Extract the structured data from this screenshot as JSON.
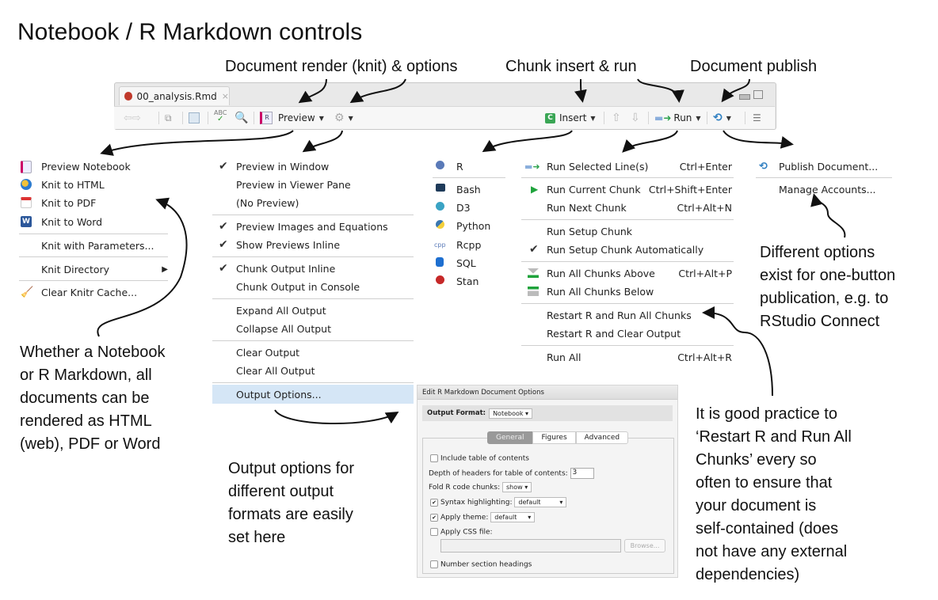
{
  "title": "Notebook / R Markdown controls",
  "callouts": {
    "render": "Document render (knit) & options",
    "chunk": "Chunk insert & run",
    "publish": "Document publish"
  },
  "editor": {
    "tab_label": "00_analysis.Rmd",
    "toolbar": {
      "preview_label": "Preview",
      "insert_label": "Insert",
      "run_label": "Run"
    }
  },
  "knit_menu": {
    "items": [
      {
        "label": "Preview Notebook",
        "icon": "notebook-icon"
      },
      {
        "label": "Knit to HTML",
        "icon": "html-globe-icon"
      },
      {
        "label": "Knit to PDF",
        "icon": "pdf-icon"
      },
      {
        "label": "Knit to Word",
        "icon": "word-icon"
      },
      {
        "label": "Knit with Parameters..."
      },
      {
        "label": "Knit Directory",
        "submenu": true
      },
      {
        "label": "Clear Knitr Cache...",
        "icon": "broom-icon"
      }
    ]
  },
  "options_menu": {
    "items": [
      {
        "label": "Preview in Window",
        "checked": true
      },
      {
        "label": "Preview in Viewer Pane",
        "checked": false
      },
      {
        "label": "(No Preview)",
        "checked": false
      },
      {
        "label": "Preview Images and Equations",
        "checked": true
      },
      {
        "label": "Show Previews Inline",
        "checked": true
      },
      {
        "label": "Chunk Output Inline",
        "checked": true
      },
      {
        "label": "Chunk Output in Console",
        "checked": false
      },
      {
        "label": "Expand All Output"
      },
      {
        "label": "Collapse All Output"
      },
      {
        "label": "Clear Output"
      },
      {
        "label": "Clear All Output"
      },
      {
        "label": "Output Options...",
        "highlighted": true
      }
    ]
  },
  "insert_menu": {
    "items": [
      {
        "label": "R"
      },
      {
        "label": "Bash"
      },
      {
        "label": "D3"
      },
      {
        "label": "Python"
      },
      {
        "label": "Rcpp"
      },
      {
        "label": "SQL"
      },
      {
        "label": "Stan"
      }
    ]
  },
  "run_menu": {
    "items": [
      {
        "label": "Run Selected Line(s)",
        "shortcut": "Ctrl+Enter"
      },
      {
        "label": "Run Current Chunk",
        "shortcut": "Ctrl+Shift+Enter"
      },
      {
        "label": "Run Next Chunk",
        "shortcut": "Ctrl+Alt+N"
      },
      {
        "label": "Run Setup Chunk",
        "shortcut": ""
      },
      {
        "label": "Run Setup Chunk Automatically",
        "shortcut": "",
        "checked": true
      },
      {
        "label": "Run All Chunks Above",
        "shortcut": "Ctrl+Alt+P"
      },
      {
        "label": "Run All Chunks Below",
        "shortcut": ""
      },
      {
        "label": "Restart R and Run All Chunks",
        "shortcut": ""
      },
      {
        "label": "Restart R and Clear Output",
        "shortcut": ""
      },
      {
        "label": "Run All",
        "shortcut": "Ctrl+Alt+R"
      }
    ]
  },
  "publish_menu": {
    "items": [
      {
        "label": "Publish Document..."
      },
      {
        "label": "Manage Accounts..."
      }
    ]
  },
  "notes": {
    "left": [
      "Whether a Notebook",
      "or R Markdown, all",
      "documents can be",
      "rendered as HTML",
      "(web), PDF or Word"
    ],
    "output": [
      "Output options for",
      "different output",
      "formats are easily",
      "set here"
    ],
    "publish": [
      "Different options",
      "exist for one-button",
      "publication, e.g. to",
      "RStudio Connect"
    ],
    "restart": [
      "It is good practice to",
      "‘Restart R and Run All",
      "Chunks’ every so",
      "often to ensure that",
      "your document is",
      "self-contained (does",
      "not have any external",
      "dependencies)"
    ]
  },
  "dialog": {
    "title": "Edit R Markdown Document Options",
    "output_format_label": "Output Format:",
    "output_format_value": "Notebook",
    "tabs": [
      "General",
      "Figures",
      "Advanced"
    ],
    "active_tab": "General",
    "include_toc_label": "Include table of contents",
    "include_toc_checked": false,
    "toc_depth_label": "Depth of headers for table of contents:",
    "toc_depth_value": "3",
    "fold_label": "Fold R code chunks:",
    "fold_value": "show",
    "syntax_label": "Syntax highlighting:",
    "syntax_value": "default",
    "syntax_checked": true,
    "theme_label": "Apply theme:",
    "theme_value": "default",
    "theme_checked": true,
    "css_label": "Apply CSS file:",
    "css_checked": false,
    "css_value": "",
    "browse_label": "Browse...",
    "number_label": "Number section headings",
    "number_checked": false
  }
}
